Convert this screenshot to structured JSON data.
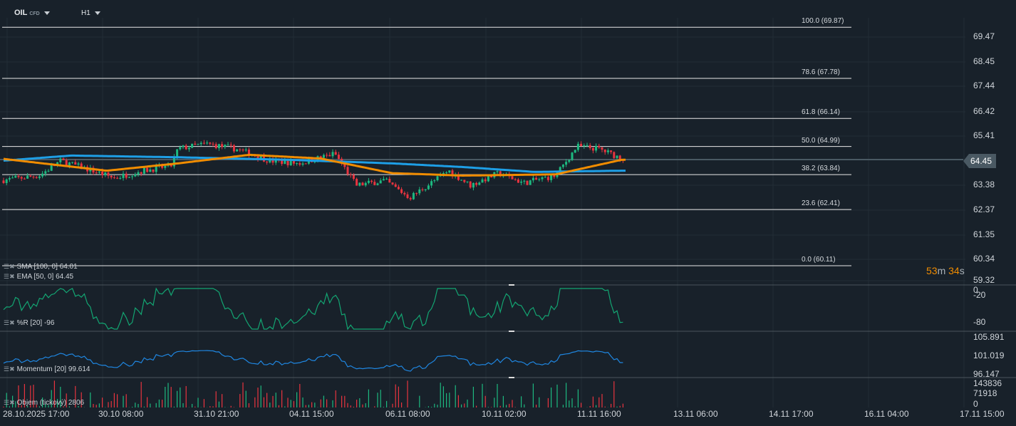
{
  "header": {
    "symbol": "OIL",
    "symbol_type": "CFD",
    "timeframe": "H1"
  },
  "colors": {
    "bull": "#1db980",
    "bear": "#e8343f",
    "sma": "#1e9fe6",
    "ema": "#f08c00",
    "pct_r": "#13a572",
    "momentum": "#1f86e0",
    "countdown": "#f08c00"
  },
  "price_axis": [
    "69.47",
    "68.45",
    "67.44",
    "66.42",
    "65.41",
    "64.45",
    "63.38",
    "62.37",
    "61.35",
    "60.34",
    "59.32"
  ],
  "current_price": "64.45",
  "fibonacci": [
    {
      "level": "100.0 (69.87)",
      "price": 69.87
    },
    {
      "level": "78.6 (67.78)",
      "price": 67.78
    },
    {
      "level": "61.8 (66.14)",
      "price": 66.14
    },
    {
      "level": "50.0 (64.99)",
      "price": 64.99
    },
    {
      "level": "38.2 (63.84)",
      "price": 63.84
    },
    {
      "level": "23.6 (62.41)",
      "price": 62.41
    },
    {
      "level": "0.0 (60.11)",
      "price": 60.11
    }
  ],
  "countdown": {
    "minutes": "53",
    "m": "m",
    "seconds": "34",
    "s": "s"
  },
  "legend": {
    "sma": "SMA [100, 0] 64.01",
    "ema": "EMA [50, 0] 64.45",
    "pct_r": "%R [20] -96",
    "momentum": "Momentum [20] 99.614",
    "volume": "Objem (tickový) 2806"
  },
  "pct_r_axis": [
    "0",
    "-20",
    "-80"
  ],
  "momentum_axis": [
    "105.891",
    "101.019",
    "96.147"
  ],
  "volume_axis": [
    "143836",
    "71918",
    "0"
  ],
  "dates": [
    "28.10.2025 17:00",
    "30.10 08:00",
    "31.10 21:00",
    "04.11 15:00",
    "06.11 08:00",
    "10.11 02:00",
    "11.11 16:00",
    "13.11 06:00",
    "14.11 17:00",
    "16.11 04:00",
    "17.11 15:00"
  ],
  "chart_data": {
    "type": "candlestick",
    "price_path": [
      [
        0,
        63.6
      ],
      [
        55,
        63.8
      ],
      [
        85,
        64.4
      ],
      [
        130,
        64.0
      ],
      [
        160,
        63.7
      ],
      [
        200,
        64.0
      ],
      [
        240,
        64.2
      ],
      [
        250,
        64.9
      ],
      [
        290,
        65.1
      ],
      [
        330,
        64.9
      ],
      [
        380,
        64.4
      ],
      [
        420,
        64.3
      ],
      [
        470,
        64.7
      ],
      [
        500,
        63.4
      ],
      [
        540,
        63.6
      ],
      [
        575,
        62.9
      ],
      [
        600,
        63.4
      ],
      [
        630,
        64.0
      ],
      [
        660,
        63.4
      ],
      [
        700,
        63.9
      ],
      [
        735,
        63.5
      ],
      [
        780,
        63.8
      ],
      [
        810,
        65.0
      ],
      [
        840,
        64.9
      ],
      [
        873,
        64.5
      ]
    ],
    "sma_path": [
      [
        0,
        64.4
      ],
      [
        100,
        64.62
      ],
      [
        250,
        64.55
      ],
      [
        400,
        64.45
      ],
      [
        550,
        64.3
      ],
      [
        650,
        64.15
      ],
      [
        750,
        63.95
      ],
      [
        873,
        64.0
      ]
    ],
    "ema_path": [
      [
        0,
        64.5
      ],
      [
        150,
        64.0
      ],
      [
        250,
        64.3
      ],
      [
        350,
        64.65
      ],
      [
        450,
        64.5
      ],
      [
        550,
        63.9
      ],
      [
        650,
        63.8
      ],
      [
        780,
        63.85
      ],
      [
        873,
        64.45
      ]
    ]
  }
}
